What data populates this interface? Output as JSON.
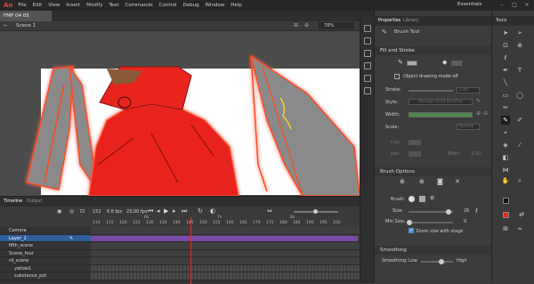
{
  "app": {
    "logo": "An"
  },
  "menu": [
    "File",
    "Edit",
    "View",
    "Insert",
    "Modify",
    "Text",
    "Commands",
    "Control",
    "Debug",
    "Window",
    "Help"
  ],
  "workspace": "Essentials",
  "document_tab": "FMP 04 05 _May.fla*",
  "scene": "Scene 1",
  "zoom": "78%",
  "properties": {
    "tab_properties": "Properties",
    "tab_library": "Library",
    "tool_name": "Brush Tool",
    "fill_stroke_header": "Fill and Stroke",
    "object_drawing": "Object drawing mode off",
    "stroke_label": "Stroke:",
    "stroke_value": "1.00",
    "style_label": "Style:",
    "style_value": "Manage Paint Brushes",
    "width_label": "Width:",
    "scale_label": "Scale:",
    "scale_value": "Normal",
    "cap_label": "Cap:",
    "join_label": "Join:",
    "miter_label": "Miter:",
    "miter_value": "3.00",
    "brush_options_header": "Brush Options",
    "brush_label": "Brush:",
    "size_label": "Size:",
    "size_value": "26",
    "min_size_label": "Min Size:",
    "min_size_value": "0",
    "zoom_with_stage": "Zoom size with stage",
    "smoothing_header": "Smoothing",
    "smoothing_label": "Smoothing:",
    "smoothing_low": "Low",
    "smoothing_high": "High"
  },
  "tools_header": "Tools",
  "timeline": {
    "tab_timeline": "Timeline",
    "tab_output": "Output",
    "frame": "152",
    "fps": "6.6 fps",
    "time": "23.00 fps",
    "ruler_seconds": [
      "6s",
      "7s",
      "8s"
    ],
    "ruler": [
      "110",
      "115",
      "120",
      "125",
      "130",
      "135",
      "140",
      "145",
      "150",
      "155",
      "160",
      "165",
      "170",
      "175",
      "180",
      "185",
      "190",
      "195",
      "200"
    ],
    "layers": [
      "Camera",
      "Layer_1",
      "fifth_scene",
      "Scene_four",
      "rd_scene",
      "yellow1",
      "substance_pot"
    ]
  },
  "colors": {
    "accent": "#4a90d9",
    "cape_red": "#e8241c",
    "wing_gray": "#8a8a8a",
    "glow": "#ff6030"
  }
}
